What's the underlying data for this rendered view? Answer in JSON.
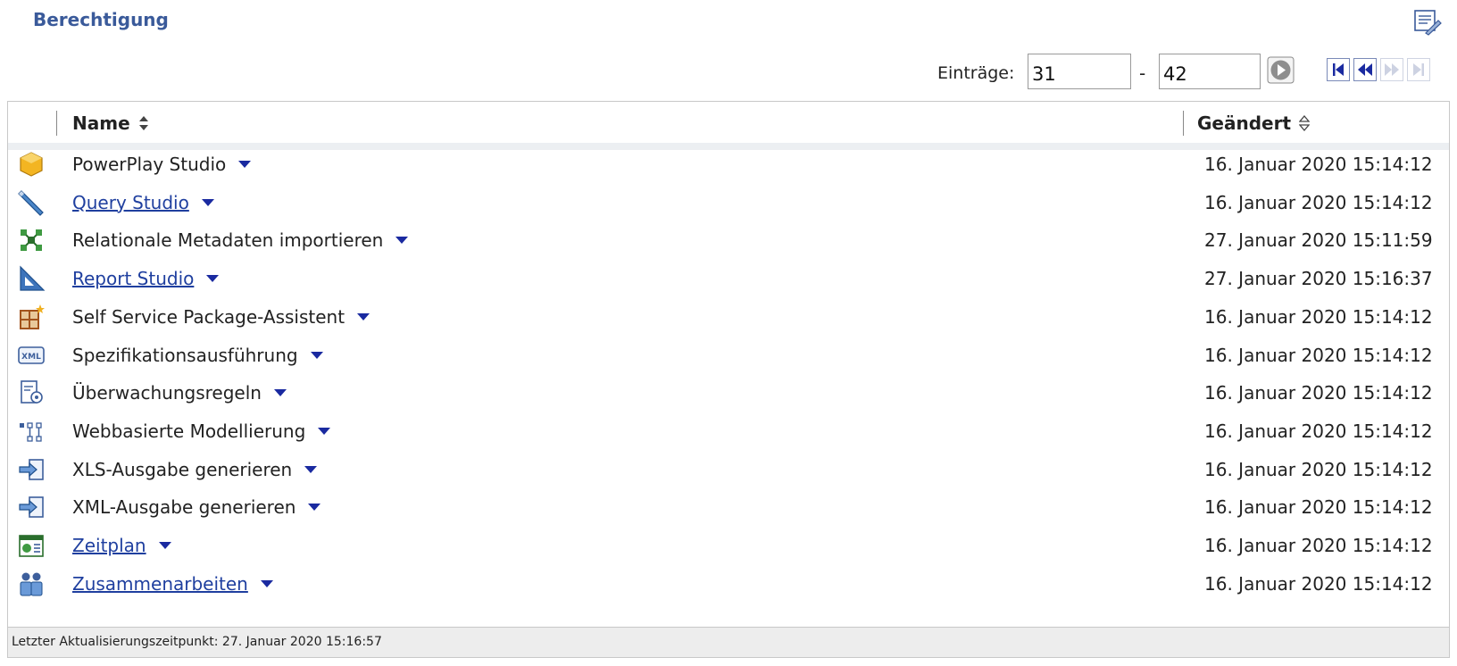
{
  "page": {
    "title": "Berechtigung"
  },
  "pager": {
    "label": "Einträge:",
    "from": "31",
    "dash": "-",
    "to": "42"
  },
  "table": {
    "columns": {
      "name": "Name",
      "changed": "Geändert"
    },
    "rows": [
      {
        "name": "PowerPlay Studio",
        "date": "16. Januar 2020 15:14:12",
        "link": false,
        "icon": "powerplay-cube-icon"
      },
      {
        "name": "Query Studio",
        "date": "16. Januar 2020 15:14:12",
        "link": true,
        "icon": "query-pencil-icon"
      },
      {
        "name": "Relationale Metadaten importieren",
        "date": "27. Januar 2020 15:11:59",
        "link": false,
        "icon": "metadata-import-icon"
      },
      {
        "name": "Report Studio",
        "date": "27. Januar 2020 15:16:37",
        "link": true,
        "icon": "set-square-icon"
      },
      {
        "name": "Self Service Package-Assistent",
        "date": "16. Januar 2020 15:14:12",
        "link": false,
        "icon": "package-wizard-icon"
      },
      {
        "name": "Spezifikationsausführung",
        "date": "16. Januar 2020 15:14:12",
        "link": false,
        "icon": "xml-badge-icon"
      },
      {
        "name": "Überwachungsregeln",
        "date": "16. Januar 2020 15:14:12",
        "link": false,
        "icon": "rules-document-icon"
      },
      {
        "name": "Webbasierte Modellierung",
        "date": "16. Januar 2020 15:14:12",
        "link": false,
        "icon": "modeling-nodes-icon"
      },
      {
        "name": "XLS-Ausgabe generieren",
        "date": "16. Januar 2020 15:14:12",
        "link": false,
        "icon": "export-arrow-icon"
      },
      {
        "name": "XML-Ausgabe generieren",
        "date": "16. Januar 2020 15:14:12",
        "link": false,
        "icon": "export-arrow-icon"
      },
      {
        "name": "Zeitplan",
        "date": "16. Januar 2020 15:14:12",
        "link": true,
        "icon": "schedule-calendar-icon"
      },
      {
        "name": "Zusammenarbeiten",
        "date": "16. Januar 2020 15:14:12",
        "link": true,
        "icon": "collaboration-people-icon"
      }
    ]
  },
  "footer": {
    "text": "Letzter Aktualisierungszeitpunkt: 27. Januar 2020 15:16:57"
  },
  "colors": {
    "title": "#3a5a9a",
    "link": "#1f3f9f",
    "caret": "#1a2aa0"
  }
}
